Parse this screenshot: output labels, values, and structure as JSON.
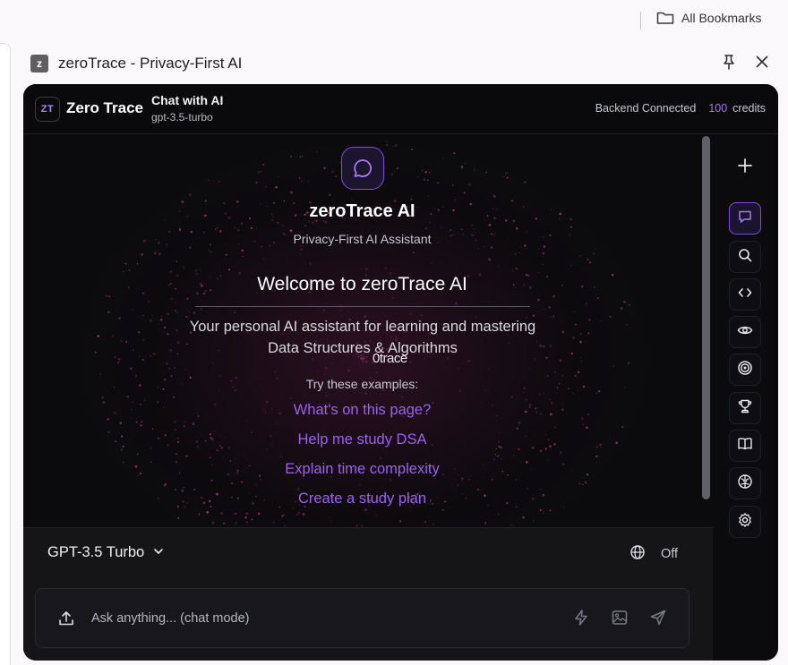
{
  "browser": {
    "bookmarks_label": "All Bookmarks",
    "panel_favicon": "z",
    "panel_title": "zeroTrace - Privacy-First AI"
  },
  "header": {
    "logo_text": "ZT",
    "brand": "Zero Trace",
    "chat_title": "Chat with AI",
    "model": "gpt-3.5-turbo",
    "status": "Backend Connected",
    "credits_value": "100",
    "credits_label": "credits"
  },
  "hero": {
    "title": "zeroTrace AI",
    "subtitle": "Privacy-First AI Assistant",
    "welcome": "Welcome to zeroTrace AI",
    "description": "Your personal AI assistant for learning and mastering Data Structures & Algorithms",
    "watermark": "0trace",
    "examples_heading": "Try these examples:",
    "examples": [
      "What's on this page?",
      "Help me study DSA",
      "Explain time complexity",
      "Create a study plan"
    ]
  },
  "sidebar_icons": [
    "plus-icon",
    "chat-icon",
    "search-icon",
    "code-icon",
    "eye-icon",
    "target-icon",
    "trophy-icon",
    "book-icon",
    "brain-icon",
    "settings-icon"
  ],
  "composer": {
    "model_selected": "GPT-3.5 Turbo",
    "web_search_state": "Off",
    "placeholder": "Ask anything... (chat mode)"
  },
  "colors": {
    "accent": "#9a62ee",
    "background": "#0b0b0d",
    "credits": "#9f7aea"
  }
}
